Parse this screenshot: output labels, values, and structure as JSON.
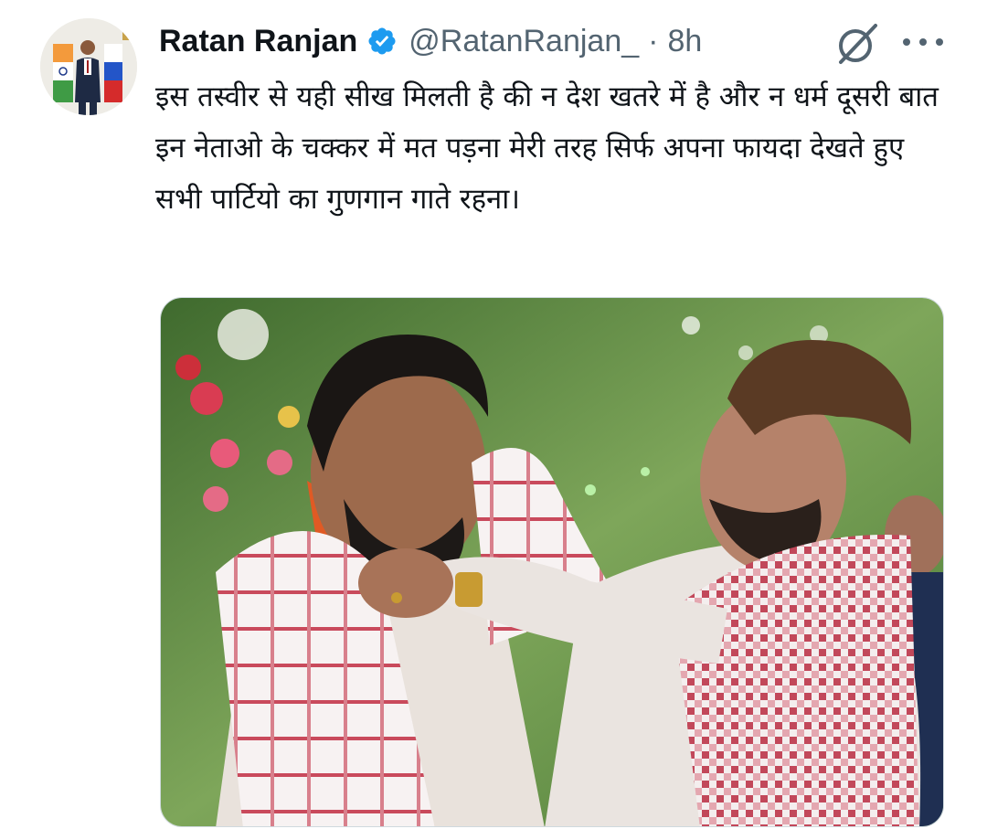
{
  "author": {
    "display_name": "Ratan Ranjan",
    "handle": "@RatanRanjan_",
    "separator": "·",
    "time": "8h",
    "verified": true
  },
  "tweet": {
    "text": "इस तस्वीर से यही सीख मिलती है की न देश खतरे में है और न धर्म दूसरी बात इन नेताओ के चक्कर में मत पड़ना मेरी तरह सिर्फ अपना फायदा देखते हुए सभी पार्टियो का गुणगान गाते रहना।"
  },
  "icons": {
    "verified": "verified-badge-icon",
    "grok": "grok-icon",
    "more": "more-dots-icon"
  },
  "colors": {
    "verified_blue": "#1d9bf0",
    "secondary_text": "#536471",
    "primary_text": "#0f1419"
  }
}
